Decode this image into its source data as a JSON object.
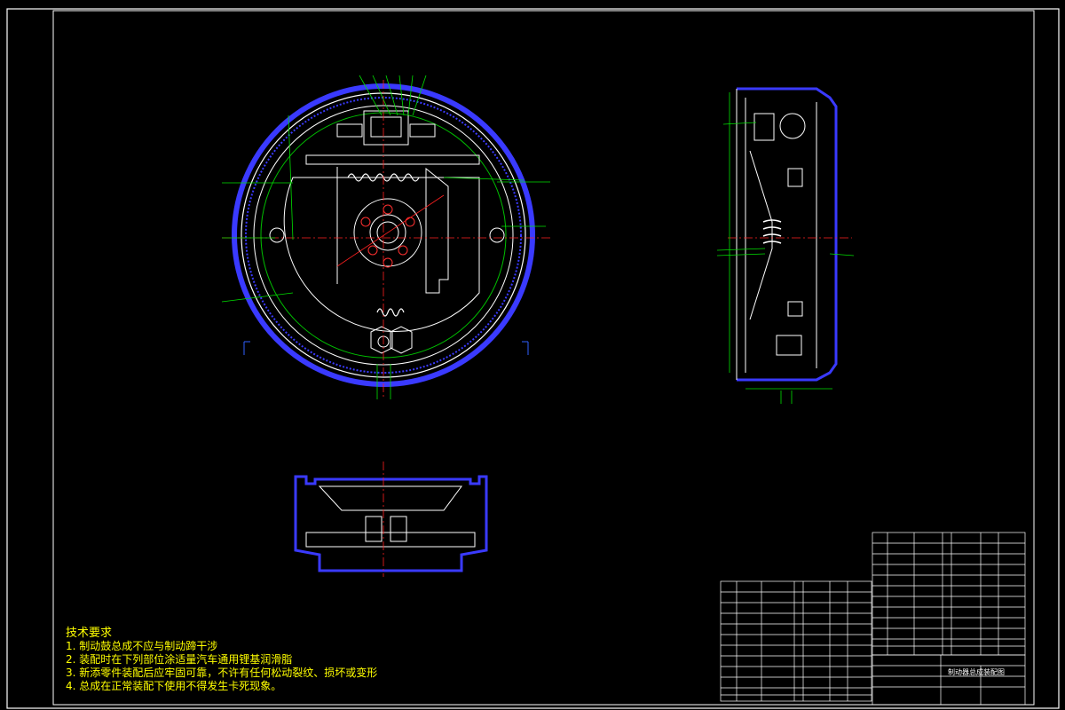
{
  "drawing": {
    "title_block_text": "制动器总成装配图",
    "tech_requirements": {
      "heading": "技术要求",
      "items": [
        "1. 制动鼓总成不应与制动蹄干涉",
        "2. 装配时在下列部位涂适量汽车通用锂基润滑脂",
        "3. 新添零件装配后应牢固可靠，不许有任何松动裂纹、损坏或变形",
        "4. 总成在正常装配下使用不得发生卡死现象。"
      ]
    },
    "colors": {
      "background": "#000000",
      "frame": "#ffffff",
      "outline": "#ffffff",
      "dimension": "#00ff00",
      "hidden": "#0000ff",
      "center": "#ff0000",
      "text_yellow": "#ffff00"
    }
  }
}
